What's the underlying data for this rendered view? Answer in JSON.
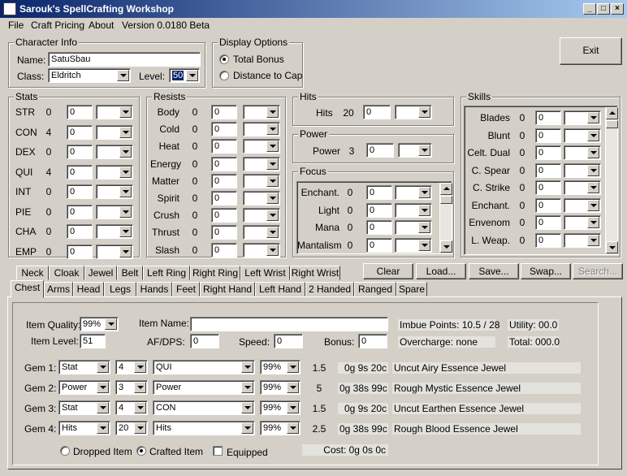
{
  "window": {
    "title": "Sarouk's SpellCrafting Workshop"
  },
  "menu": [
    "File",
    "Craft Pricing",
    "About",
    "Version 0.0180 Beta"
  ],
  "character": {
    "group": "Character Info",
    "name_label": "Name:",
    "name": "SatuSbau",
    "class_label": "Class:",
    "class": "Eldritch",
    "level_label": "Level:",
    "level": "50"
  },
  "display": {
    "group": "Display Options",
    "total": "Total Bonus",
    "cap": "Distance to Cap",
    "selected": "total"
  },
  "exit_label": "Exit",
  "stats": {
    "group": "Stats",
    "rows": [
      {
        "label": "STR",
        "value": "0",
        "input": "0"
      },
      {
        "label": "CON",
        "value": "4",
        "input": "0"
      },
      {
        "label": "DEX",
        "value": "0",
        "input": "0"
      },
      {
        "label": "QUI",
        "value": "4",
        "input": "0"
      },
      {
        "label": "INT",
        "value": "0",
        "input": "0"
      },
      {
        "label": "PIE",
        "value": "0",
        "input": "0"
      },
      {
        "label": "CHA",
        "value": "0",
        "input": "0"
      },
      {
        "label": "EMP",
        "value": "0",
        "input": "0"
      }
    ]
  },
  "resists": {
    "group": "Resists",
    "rows": [
      {
        "label": "Body",
        "value": "0",
        "input": "0"
      },
      {
        "label": "Cold",
        "value": "0",
        "input": "0"
      },
      {
        "label": "Heat",
        "value": "0",
        "input": "0"
      },
      {
        "label": "Energy",
        "value": "0",
        "input": "0"
      },
      {
        "label": "Matter",
        "value": "0",
        "input": "0"
      },
      {
        "label": "Spirit",
        "value": "0",
        "input": "0"
      },
      {
        "label": "Crush",
        "value": "0",
        "input": "0"
      },
      {
        "label": "Thrust",
        "value": "0",
        "input": "0"
      },
      {
        "label": "Slash",
        "value": "0",
        "input": "0"
      }
    ]
  },
  "hits": {
    "group": "Hits",
    "label": "Hits",
    "value": "20",
    "input": "0"
  },
  "power": {
    "group": "Power",
    "label": "Power",
    "value": "3",
    "input": "0"
  },
  "focus": {
    "group": "Focus",
    "rows": [
      {
        "label": "Enchant.",
        "value": "0",
        "input": "0"
      },
      {
        "label": "Light",
        "value": "0",
        "input": "0"
      },
      {
        "label": "Mana",
        "value": "0",
        "input": "0"
      },
      {
        "label": "Mantalism",
        "value": "0",
        "input": "0"
      }
    ]
  },
  "skills": {
    "group": "Skills",
    "rows": [
      {
        "label": "Blades",
        "value": "0",
        "input": "0"
      },
      {
        "label": "Blunt",
        "value": "0",
        "input": "0"
      },
      {
        "label": "Celt. Dual",
        "value": "0",
        "input": "0"
      },
      {
        "label": "C. Spear",
        "value": "0",
        "input": "0"
      },
      {
        "label": "C. Strike",
        "value": "0",
        "input": "0"
      },
      {
        "label": "Enchant.",
        "value": "0",
        "input": "0"
      },
      {
        "label": "Envenom",
        "value": "0",
        "input": "0"
      },
      {
        "label": "L. Weap.",
        "value": "0",
        "input": "0"
      }
    ]
  },
  "tabs_row1": [
    "Neck",
    "Cloak",
    "Jewel",
    "Belt",
    "Left Ring",
    "Right Ring",
    "Left Wrist",
    "Right Wrist"
  ],
  "tabs_row2": [
    "Chest",
    "Arms",
    "Head",
    "Legs",
    "Hands",
    "Feet",
    "Right Hand",
    "Left Hand",
    "2 Handed",
    "Ranged",
    "Spare"
  ],
  "active_tab": "Chest",
  "actions": {
    "clear": "Clear",
    "load": "Load...",
    "save": "Save...",
    "swap": "Swap...",
    "search": "Search..."
  },
  "item": {
    "quality_label": "Item Quality:",
    "quality": "99%",
    "level_label": "Item Level:",
    "level": "51",
    "name_label": "Item Name:",
    "name": "",
    "afdps_label": "AF/DPS:",
    "afdps": "0",
    "speed_label": "Speed:",
    "speed": "0",
    "bonus_label": "Bonus:",
    "bonus": "0",
    "imbue": "Imbue Points: 10.5 / 28",
    "utility": "Utility: 00.0",
    "overcharge": "Overcharge: none",
    "total": "Total: 000.0"
  },
  "gems": [
    {
      "label": "Gem 1:",
      "type": "Stat",
      "amount": "4",
      "effect": "QUI",
      "quality": "99%",
      "points": "1.5",
      "cost": "0g 9s 20c",
      "name": "Uncut Airy Essence Jewel"
    },
    {
      "label": "Gem 2:",
      "type": "Power",
      "amount": "3",
      "effect": "Power",
      "quality": "99%",
      "points": "5",
      "cost": "0g 38s 99c",
      "name": "Rough Mystic Essence Jewel"
    },
    {
      "label": "Gem 3:",
      "type": "Stat",
      "amount": "4",
      "effect": "CON",
      "quality": "99%",
      "points": "1.5",
      "cost": "0g 9s 20c",
      "name": "Uncut Earthen Essence Jewel"
    },
    {
      "label": "Gem 4:",
      "type": "Hits",
      "amount": "20",
      "effect": "Hits",
      "quality": "99%",
      "points": "2.5",
      "cost": "0g 38s 99c",
      "name": "Rough Blood Essence Jewel"
    }
  ],
  "footer": {
    "dropped": "Dropped Item",
    "crafted": "Crafted Item",
    "equipped": "Equipped",
    "selected": "crafted",
    "cost": "Cost: 0g 0s 0c"
  }
}
